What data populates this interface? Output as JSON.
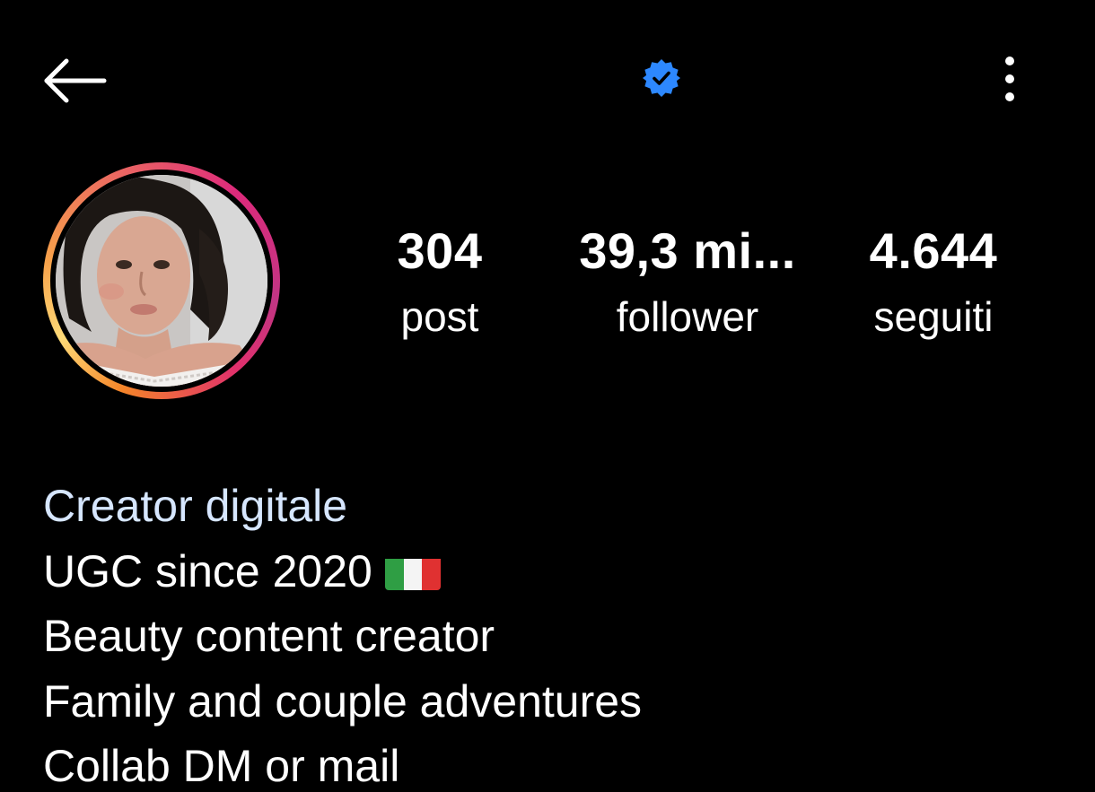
{
  "header": {
    "back_icon": "arrow-left-icon",
    "verified_icon": "verified-badge-icon",
    "verified_color": "#2d88ff",
    "menu_icon": "vertical-ellipsis-icon"
  },
  "profile": {
    "avatar": "profile-photo",
    "story_ring_colors": [
      "#feda77",
      "#f58529",
      "#dd2a7b",
      "#c13584"
    ],
    "stats": [
      {
        "value": "304",
        "label": "post"
      },
      {
        "value": "39,3 mi...",
        "label": "follower"
      },
      {
        "value": "4.644",
        "label": "seguiti"
      }
    ]
  },
  "bio": {
    "category": "Creator digitale",
    "category_color": "#d6e6ff",
    "lines": [
      "UGC since 2020",
      "Beauty content creator",
      "Family and couple adventures",
      "Collab DM or mail"
    ],
    "flag_emoji": "italy-flag-icon"
  }
}
